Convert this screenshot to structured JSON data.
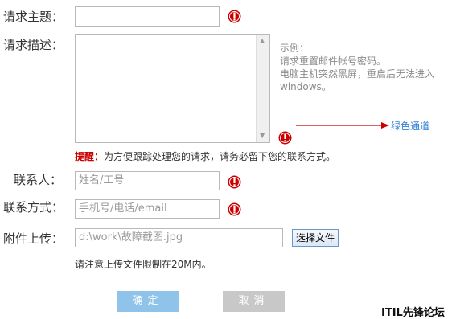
{
  "form": {
    "subject_label": "请求主题：",
    "description_label": "请求描述：",
    "contact_label": "联系人：",
    "contact_method_label": "联系方式：",
    "attachment_label": "附件上传：",
    "subject_value": "",
    "contact_placeholder": "姓名/工号",
    "contact_method_placeholder": "手机号/电话/email",
    "attachment_path": "d:\\work\\故障截图.jpg",
    "choose_file_label": "选择文件",
    "upload_note": "请注意上传文件限制在20M内。"
  },
  "example": {
    "line1": "示例：",
    "line2": "请求重置邮件帐号密码。",
    "line3": "电脑主机突然黑屏，重启后无法进入",
    "line4": "windows。"
  },
  "green_channel_label": "绿色通道",
  "hint": {
    "prefix": "提醒：",
    "text": "为方便跟踪处理您的请求，请务必留下您的联系方式。"
  },
  "buttons": {
    "confirm": "确定",
    "cancel": "取消"
  },
  "watermark": "ITIL先锋论坛",
  "colors": {
    "confirm_bg": "#8fc3ea",
    "cancel_bg": "#c8c8c8",
    "required_icon": "#cc0000",
    "arrow": "#cc0000",
    "link": "#2f7fd6"
  },
  "icons": {
    "required": "exclamation-circle-icon",
    "arrow": "right-arrow-icon"
  }
}
